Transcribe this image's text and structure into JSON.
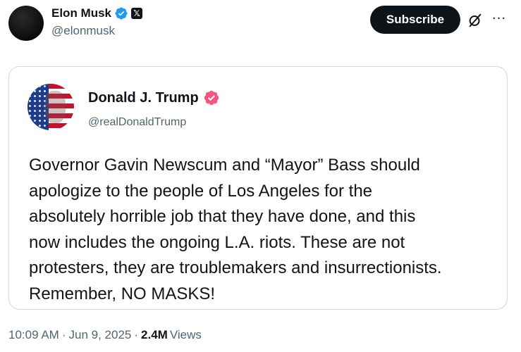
{
  "author": {
    "name": "Elon Musk",
    "handle": "@elonmusk"
  },
  "actions": {
    "subscribe_label": "Subscribe",
    "grok_icon": "grok-icon",
    "more_icon": "more-icon"
  },
  "quote": {
    "name": "Donald J. Trump",
    "handle": "@realDonaldTrump",
    "text": "Governor Gavin Newscum and “Mayor” Bass should\napologize to the people of Los Angeles for the\nabsolutely horrible job that they have done, and this\nnow includes the ongoing L.A. riots. These are not\nprotesters, they are troublemakers and insurrectionists.\nRemember, NO MASKS!"
  },
  "meta": {
    "time": "10:09 AM",
    "date": "Jun 9, 2025",
    "views_count": "2.4M",
    "views_label": "Views",
    "separator": "·"
  },
  "colors": {
    "verified_blue": "#1d9bf0",
    "verified_red": "#f4577d",
    "text_primary": "#0f1419",
    "text_secondary": "#536471",
    "border": "#cfd9de"
  }
}
